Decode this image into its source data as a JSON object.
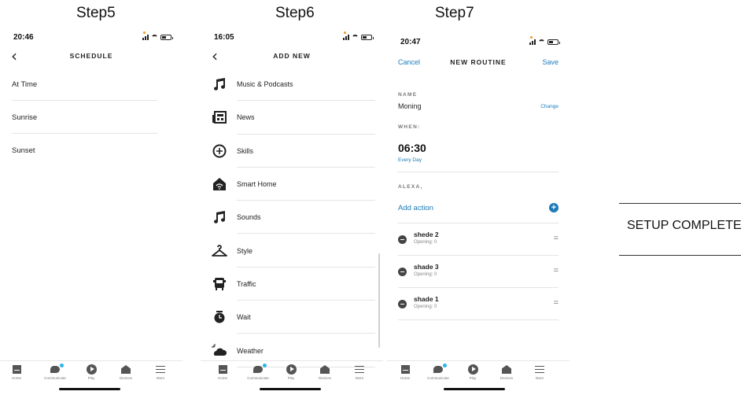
{
  "steps": {
    "step5": "Step5",
    "step6": "Step6",
    "step7": "Step7"
  },
  "phone1": {
    "time": "20:46",
    "title": "SCHEDULE",
    "items": [
      "At Time",
      "Sunrise",
      "Sunset"
    ]
  },
  "phone2": {
    "time": "16:05",
    "title": "ADD NEW",
    "items": [
      {
        "label": "Music & Podcasts",
        "icon": "music-note-icon"
      },
      {
        "label": "News",
        "icon": "news-icon"
      },
      {
        "label": "Skills",
        "icon": "skills-icon"
      },
      {
        "label": "Smart Home",
        "icon": "smart-home-icon"
      },
      {
        "label": "Sounds",
        "icon": "music-note-icon"
      },
      {
        "label": "Style",
        "icon": "hanger-icon"
      },
      {
        "label": "Traffic",
        "icon": "bus-icon"
      },
      {
        "label": "Wait",
        "icon": "alarm-clock-icon"
      },
      {
        "label": "Weather",
        "icon": "weather-icon"
      }
    ]
  },
  "phone3": {
    "time": "20:47",
    "cancel": "Cancel",
    "title": "NEW ROUTINE",
    "save": "Save",
    "name_label": "NAME",
    "name_value": "Moning",
    "change": "Change",
    "when_label": "WHEN:",
    "when_time": "06:30",
    "when_repeat": "Every Day",
    "alexa_label": "ALEXA,",
    "add_action": "Add action",
    "actions": [
      {
        "name": "shede 2",
        "status": "Opening: 0"
      },
      {
        "name": "shade 3",
        "status": "Opening: 0"
      },
      {
        "name": "shade 1",
        "status": "Opening: 0"
      }
    ]
  },
  "tabbar": {
    "home": "Home",
    "communicate": "Communicate",
    "play": "Play",
    "devices": "Devices",
    "more": "More"
  },
  "setup_text": "SETUP COMPLETE",
  "colors": {
    "accent_blue": "#1b7bb8",
    "notification_dot": "#2bb5e8",
    "status_orange": "#f29b1d"
  }
}
